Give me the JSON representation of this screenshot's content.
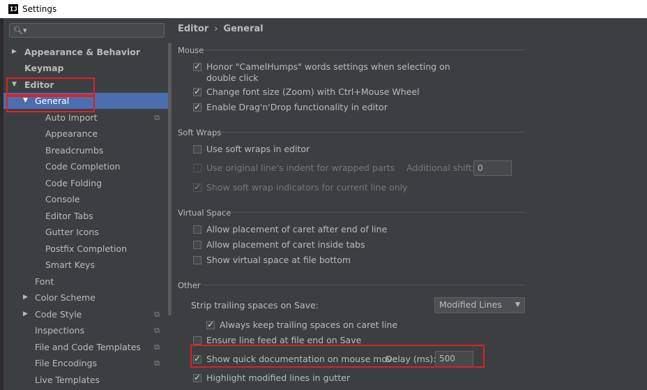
{
  "window": {
    "title": "Settings",
    "logo": "IJ"
  },
  "search": {
    "placeholder": "",
    "icon": "search-icon"
  },
  "sidebar": {
    "items": [
      {
        "label": "Appearance & Behavior",
        "arrow": "▶"
      },
      {
        "label": "Keymap",
        "arrow": ""
      },
      {
        "label": "Editor",
        "arrow": "▼"
      },
      {
        "label": "General",
        "arrow": "▼"
      },
      {
        "label": "Auto Import"
      },
      {
        "label": "Appearance"
      },
      {
        "label": "Breadcrumbs"
      },
      {
        "label": "Code Completion"
      },
      {
        "label": "Code Folding"
      },
      {
        "label": "Console"
      },
      {
        "label": "Editor Tabs"
      },
      {
        "label": "Gutter Icons"
      },
      {
        "label": "Postfix Completion"
      },
      {
        "label": "Smart Keys"
      },
      {
        "label": "Font"
      },
      {
        "label": "Color Scheme",
        "arrow": "▶"
      },
      {
        "label": "Code Style",
        "arrow": "▶"
      },
      {
        "label": "Inspections"
      },
      {
        "label": "File and Code Templates"
      },
      {
        "label": "File Encodings"
      },
      {
        "label": "Live Templates"
      }
    ]
  },
  "breadcrumb": {
    "parent": "Editor",
    "separator": "›",
    "current": "General"
  },
  "sections": {
    "mouse": {
      "title": "Mouse",
      "honor_camel": "Honor \"CamelHumps\" words settings when selecting on",
      "honor_camel_2": "double click",
      "change_font": "Change font size (Zoom) with Ctrl+Mouse Wheel",
      "drag_drop": "Enable Drag'n'Drop functionality in editor"
    },
    "soft_wraps": {
      "title": "Soft Wraps",
      "use_soft": "Use soft wraps in editor",
      "original_indent": "Use original line's indent for wrapped parts",
      "additional_shift_label": "Additional shift:",
      "additional_shift_value": "0",
      "show_indicators": "Show soft wrap indicators for current line only"
    },
    "virtual_space": {
      "title": "Virtual Space",
      "after_end": "Allow placement of caret after end of line",
      "inside_tabs": "Allow placement of caret inside tabs",
      "file_bottom": "Show virtual space at file bottom"
    },
    "other": {
      "title": "Other",
      "strip_label": "Strip trailing spaces on Save:",
      "strip_value": "Modified Lines",
      "keep_trailing": "Always keep trailing spaces on caret line",
      "ensure_feed": "Ensure line feed at file end on Save",
      "quick_doc": "Show quick documentation on mouse move",
      "delay_label": "Delay (ms):",
      "delay_value": "500",
      "highlight_modified": "Highlight modified lines in gutter"
    }
  },
  "colors": {
    "accent": "#4b6eaf",
    "highlight_box": "#e02020",
    "background": "#3c3f41"
  }
}
